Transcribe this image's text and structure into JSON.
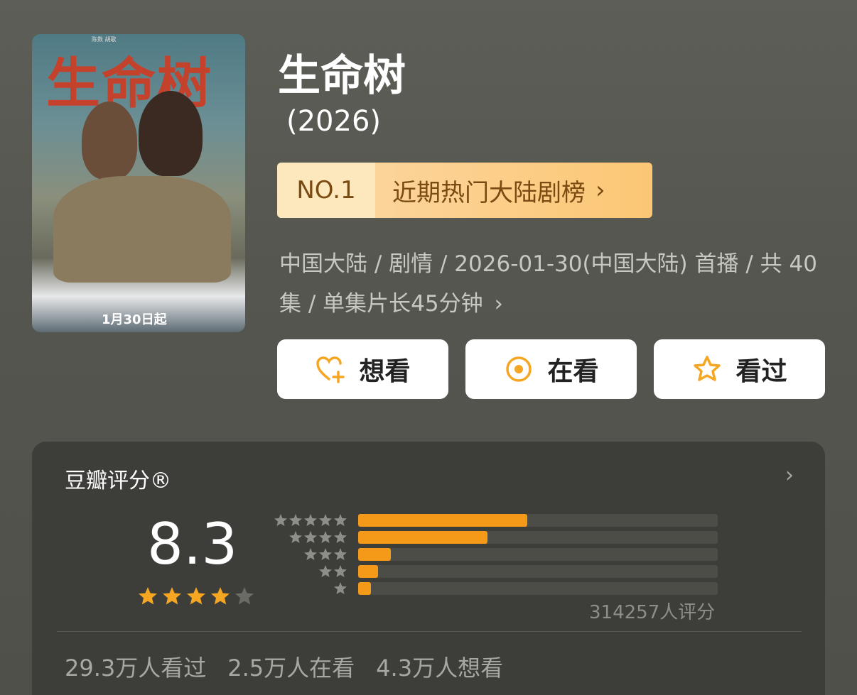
{
  "poster": {
    "title_text": "生命树",
    "date_text": "1月30日起",
    "credit_text": "陈数  胡歌"
  },
  "header": {
    "title": "生命树",
    "year": "(2026)"
  },
  "rank": {
    "number": "NO.1",
    "label": "近期热门大陆剧榜",
    "chevron": "›"
  },
  "meta": {
    "line": "中国大陆 / 剧情 / 2026-01-30(中国大陆) 首播 / 共 40集 / 单集片长45分钟",
    "chevron": "›"
  },
  "actions": {
    "want": {
      "label": "想看",
      "icon": "heart-plus-icon"
    },
    "watching": {
      "label": "在看",
      "icon": "target-icon"
    },
    "watched": {
      "label": "看过",
      "icon": "star-outline-icon"
    },
    "accent": "#f5a623"
  },
  "rating": {
    "header": "豆瓣评分®",
    "chevron": "›",
    "score": "8.3",
    "stars_filled": 4,
    "stars_total": 5,
    "distribution": [
      {
        "stars": 5,
        "fraction": 0.47
      },
      {
        "stars": 4,
        "fraction": 0.36
      },
      {
        "stars": 3,
        "fraction": 0.09
      },
      {
        "stars": 2,
        "fraction": 0.055
      },
      {
        "stars": 1,
        "fraction": 0.035
      }
    ],
    "count_text": "314257人评分",
    "bar_color": "#f59a18",
    "star_color": "#f5a623"
  },
  "stats": {
    "watched": "29.3万人看过",
    "watching": "2.5万人在看",
    "want": "4.3万人想看"
  }
}
